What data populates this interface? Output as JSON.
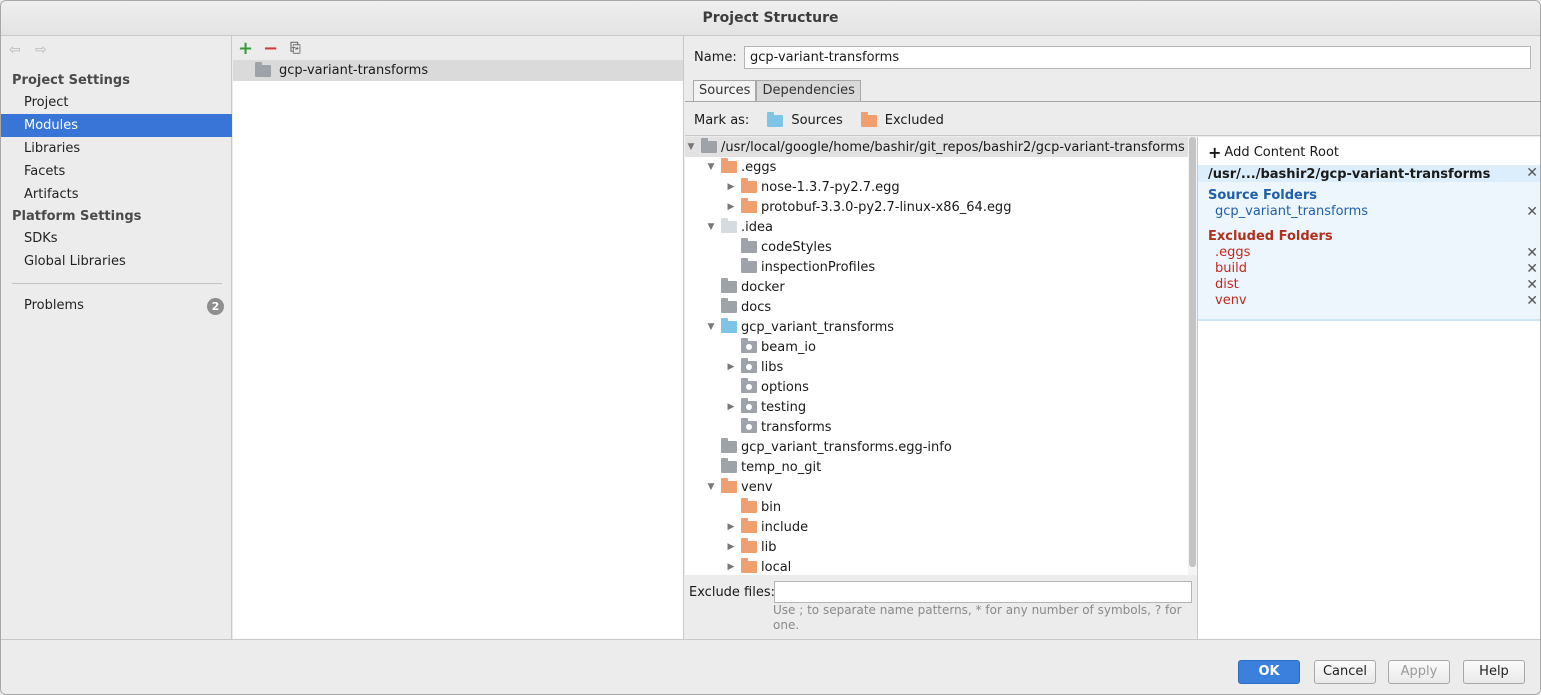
{
  "window": {
    "title": "Project Structure"
  },
  "sidebar": {
    "nav": {
      "back_icon": "arrow-left-icon",
      "forward_icon": "arrow-right-icon"
    },
    "project_settings_header": "Project Settings",
    "project_settings_items": [
      "Project",
      "Modules",
      "Libraries",
      "Facets",
      "Artifacts"
    ],
    "platform_settings_header": "Platform Settings",
    "platform_settings_items": [
      "SDKs",
      "Global Libraries"
    ],
    "problems_label": "Problems",
    "problems_count": "2",
    "selected": "Modules"
  },
  "modules": {
    "toolbar": {
      "add_icon": "plus-icon",
      "remove_icon": "minus-icon",
      "copy_icon": "copy-icon"
    },
    "items": [
      "gcp-variant-transforms"
    ]
  },
  "editor": {
    "name_label": "Name:",
    "name_value": "gcp-variant-transforms",
    "tabs": [
      "Sources",
      "Dependencies"
    ],
    "active_tab": "Sources",
    "mark_as_label": "Mark as:",
    "mark_sources": "Sources",
    "mark_excluded": "Excluded",
    "tree": [
      {
        "label": "/usr/local/google/home/bashir/git_repos/bashir2/gcp-variant-transforms",
        "arrow": "▼"
      },
      {
        "label": ".eggs",
        "arrow": "▼"
      },
      {
        "label": "nose-1.3.7-py2.7.egg",
        "arrow": "▶"
      },
      {
        "label": "protobuf-3.3.0-py2.7-linux-x86_64.egg",
        "arrow": "▶"
      },
      {
        "label": ".idea",
        "arrow": "▼"
      },
      {
        "label": "codeStyles",
        "arrow": ""
      },
      {
        "label": "inspectionProfiles",
        "arrow": ""
      },
      {
        "label": "docker",
        "arrow": ""
      },
      {
        "label": "docs",
        "arrow": ""
      },
      {
        "label": "gcp_variant_transforms",
        "arrow": "▼"
      },
      {
        "label": "beam_io",
        "arrow": ""
      },
      {
        "label": "libs",
        "arrow": "▶"
      },
      {
        "label": "options",
        "arrow": ""
      },
      {
        "label": "testing",
        "arrow": "▶"
      },
      {
        "label": "transforms",
        "arrow": ""
      },
      {
        "label": "gcp_variant_transforms.egg-info",
        "arrow": ""
      },
      {
        "label": "temp_no_git",
        "arrow": ""
      },
      {
        "label": "venv",
        "arrow": "▼"
      },
      {
        "label": "bin",
        "arrow": ""
      },
      {
        "label": "include",
        "arrow": "▶"
      },
      {
        "label": "lib",
        "arrow": "▶"
      },
      {
        "label": "local",
        "arrow": "▶"
      }
    ],
    "exclude_files_label": "Exclude files:",
    "exclude_files_value": "",
    "exclude_hint": "Use ; to separate name patterns, * for any number of symbols, ? for one."
  },
  "content_root": {
    "add_label": "Add Content Root",
    "path": "/usr/.../bashir2/gcp-variant-transforms",
    "source_folders_header": "Source Folders",
    "source_folders": [
      "gcp_variant_transforms"
    ],
    "excluded_folders_header": "Excluded Folders",
    "excluded_folders": [
      ".eggs",
      "build",
      "dist",
      "venv"
    ],
    "colors": {
      "source": "#1e5fa8",
      "excluded": "#b0301c",
      "excluded_item": "#c0281c"
    }
  },
  "footer": {
    "ok": "OK",
    "cancel": "Cancel",
    "apply": "Apply",
    "help": "Help"
  }
}
